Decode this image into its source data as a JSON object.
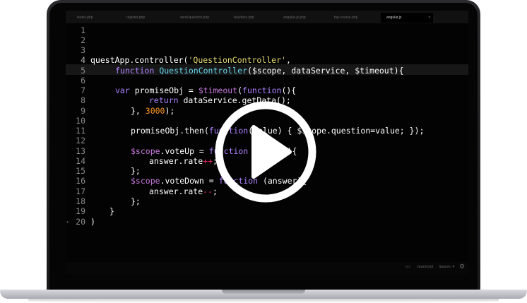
{
  "tabs": [
    "levels.php",
    "register.php",
    "send-question.php",
    "teachers.php",
    "angular-js.php",
    "top-course.php",
    "angular.js"
  ],
  "active_tab_index": 6,
  "line_numbers": [
    "1",
    "2",
    "3",
    "4",
    "5",
    "6",
    "7",
    "8",
    "9",
    "10",
    "11",
    "12",
    "13",
    "14",
    "15",
    "16",
    "17",
    "18",
    "19",
    "20"
  ],
  "code": {
    "l4_a": "questApp.controller(",
    "l4_b": "'QuestionController'",
    "l4_c": ",",
    "l5_a": "function ",
    "l5_b": "QuestionController",
    "l5_c": "($scope, dataService, $timeout){",
    "l7_a": "var ",
    "l7_b": "promiseObj = ",
    "l7_c": "$timeout",
    "l7_d": "(",
    "l7_e": "function",
    "l7_f": "(){",
    "l8_a": "return ",
    "l8_b": "dataService.getData();",
    "l9_a": "}, ",
    "l9_b": "3000",
    "l9_c": ");",
    "l11_a": "promiseObj.then(",
    "l11_b": "function",
    "l11_c": "(value) { $scope.question=value; });",
    "l13_a": "$scope",
    "l13_b": ".voteUp = ",
    "l13_c": "function",
    "l13_d": " (answer){",
    "l14_a": "answer.rate",
    "l14_b": "++",
    "l14_c": ";",
    "l15": "};",
    "l16_a": "$scope",
    "l16_b": ".voteDown = ",
    "l16_c": "function",
    "l16_d": " (answer){",
    "l17_a": "answer.rate",
    "l17_b": "--",
    "l17_c": ";",
    "l18": "};",
    "l19": "}",
    "l20": ")"
  },
  "status": {
    "left": "◁◁",
    "language": "JavaScript",
    "spaces": "Spaces: 4"
  },
  "icons": {
    "play": "play-icon",
    "settings": "gear-icon"
  },
  "colors": {
    "background": "#030303",
    "keyword": "#ae81ff",
    "string": "#e6db74",
    "function_name": "#66d9ef",
    "number": "#fd971f"
  }
}
